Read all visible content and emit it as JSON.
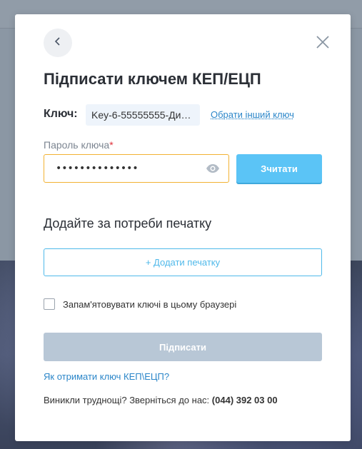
{
  "modal": {
    "title": "Підписати ключем КЕП/ЕЦП",
    "key": {
      "label": "Ключ:",
      "value": "Key-6-55555555-Ди…",
      "change_link": "Обрати інший ключ"
    },
    "password": {
      "label": "Пароль ключа",
      "required_mark": "*",
      "value": "••••••••••••••",
      "read_button": "Зчитати"
    },
    "stamp": {
      "heading": "Додайте за потреби печатку",
      "add_button": "+ Додати печатку"
    },
    "remember": {
      "label": "Запам'ятовувати ключі в цьому браузері",
      "checked": false
    },
    "sign_button": "Підписати",
    "how_link": "Як отримати ключ КЕП\\ЕЦП?",
    "help": {
      "text": "Виникли труднощі? Зверніться до нас:",
      "phone": "(044) 392 03 00"
    }
  },
  "colors": {
    "accent": "#5bc4f6",
    "link": "#2b86c9",
    "focus_border": "#f2b233",
    "disabled_button": "#b8c7d6",
    "required": "#e0323b"
  },
  "icons": {
    "back": "chevron-left-icon",
    "close": "close-icon",
    "password_toggle": "eye-icon"
  }
}
